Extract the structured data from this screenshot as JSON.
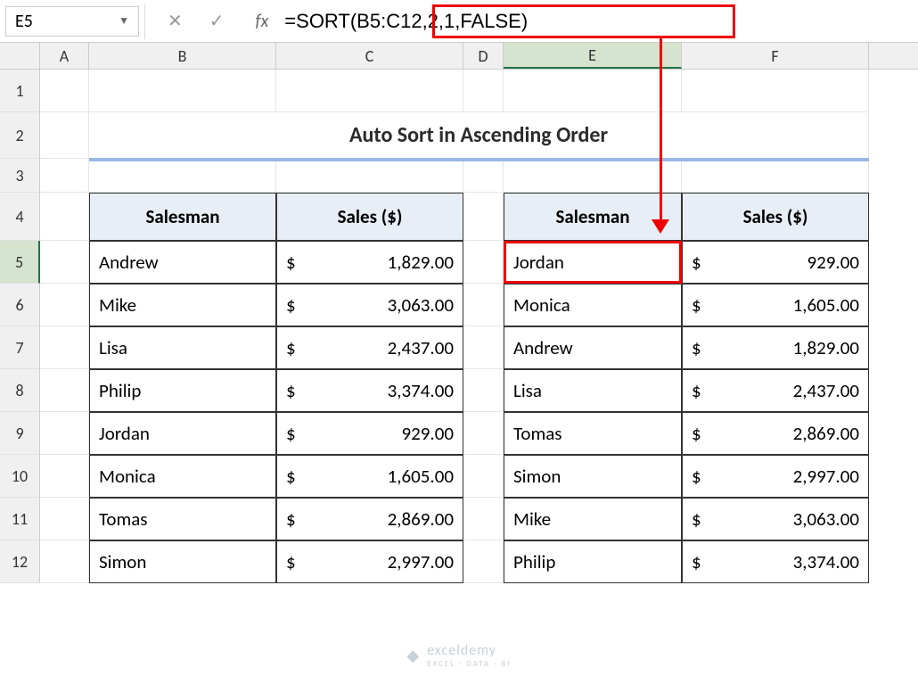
{
  "nameBox": "E5",
  "formula": "=SORT(B5:C12,2,1,FALSE)",
  "columns": [
    "A",
    "B",
    "C",
    "D",
    "E",
    "F"
  ],
  "rowNums": [
    "1",
    "2",
    "3",
    "4",
    "5",
    "6",
    "7",
    "8",
    "9",
    "10",
    "11",
    "12"
  ],
  "title": "Auto Sort in Ascending Order",
  "headers": {
    "salesman": "Salesman",
    "sales": "Sales ($)"
  },
  "left": [
    {
      "name": "Andrew",
      "val": "1,829.00"
    },
    {
      "name": "Mike",
      "val": "3,063.00"
    },
    {
      "name": "Lisa",
      "val": "2,437.00"
    },
    {
      "name": "Philip",
      "val": "3,374.00"
    },
    {
      "name": "Jordan",
      "val": "929.00"
    },
    {
      "name": "Monica",
      "val": "1,605.00"
    },
    {
      "name": "Tomas",
      "val": "2,869.00"
    },
    {
      "name": "Simon",
      "val": "2,997.00"
    }
  ],
  "right": [
    {
      "name": "Jordan",
      "val": "929.00"
    },
    {
      "name": "Monica",
      "val": "1,605.00"
    },
    {
      "name": "Andrew",
      "val": "1,829.00"
    },
    {
      "name": "Lisa",
      "val": "2,437.00"
    },
    {
      "name": "Tomas",
      "val": "2,869.00"
    },
    {
      "name": "Simon",
      "val": "2,997.00"
    },
    {
      "name": "Mike",
      "val": "3,063.00"
    },
    {
      "name": "Philip",
      "val": "3,374.00"
    }
  ],
  "currency": "$",
  "watermark": {
    "brand": "exceldemy",
    "tag": "EXCEL · DATA · BI"
  }
}
